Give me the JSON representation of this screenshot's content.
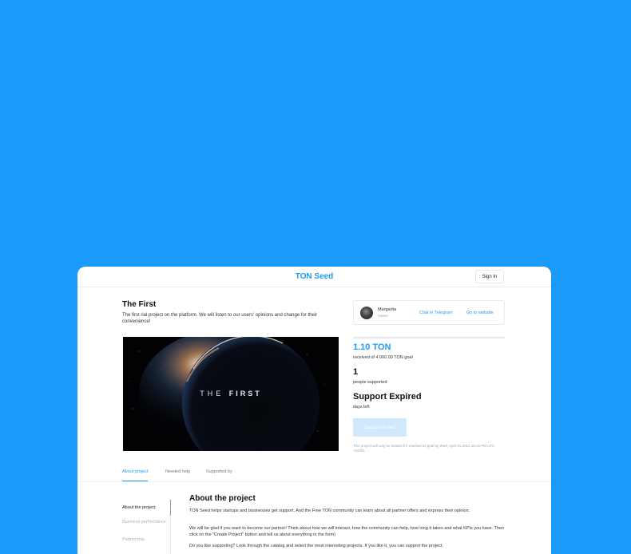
{
  "header": {
    "brand": "TON Seed",
    "signin_label": "Sign In"
  },
  "project": {
    "title": "The First",
    "description": "The first rial project on the platform. We will listen to our users' opinions and change for their convenience!",
    "cover_text_light": "THE",
    "cover_text_bold": "FIRST"
  },
  "owner": {
    "name": "Margarita",
    "role": "Owner",
    "chat_link": "Chat in Telegram",
    "website_link": "Go to website"
  },
  "stats": {
    "raised": "1.10 TON",
    "goal": "received of 4 000.00 TON goal",
    "people_count": "1",
    "people_label": "people supported",
    "status": "Support Expired",
    "days_label": "days left",
    "support_button": "Support project",
    "funding_note": "This project will only be funded if it reaches its goal by Wed, April 21 2021 16:18 PM UTC +03:00."
  },
  "tabs": [
    {
      "label": "About project",
      "active": true
    },
    {
      "label": "Needed help",
      "active": false
    },
    {
      "label": "Supported by",
      "active": false
    }
  ],
  "sidebar": {
    "items": [
      {
        "label": "About the project",
        "active": true
      },
      {
        "label": "Business performance",
        "active": false
      },
      {
        "label": "Partnership",
        "active": false
      }
    ]
  },
  "about": {
    "title": "About the project",
    "paragraphs": [
      "TON Seed helps startups and businesses get support. And the Free TON community can learn about all partner offers and express their opinion.",
      "We will be glad if you want to become our partner! Think about how we will interact, how the community can help, how long it takes and what KPIs you have. Then click on the \"Create Project\" button and tell us about everything in the form)",
      "Do you like supporting? Look through the catalog and select the most interesting projects. If you like it, you can support the project."
    ]
  },
  "colors": {
    "background": "#1a9bfb",
    "accent": "#1e9bf5",
    "disabled_button": "#cfe8fc"
  }
}
